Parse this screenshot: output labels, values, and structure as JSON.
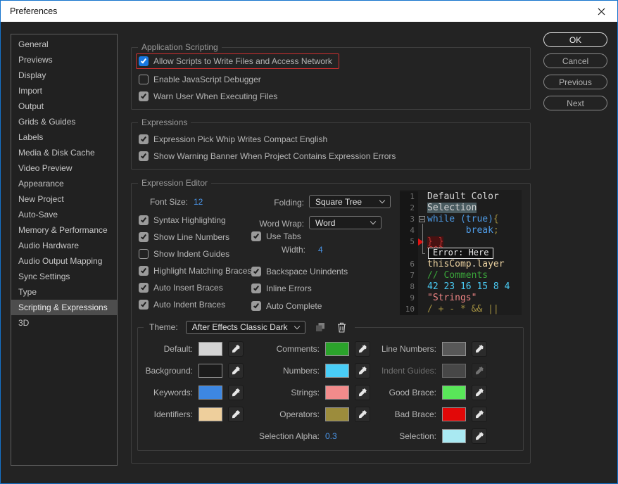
{
  "window": {
    "title": "Preferences"
  },
  "colors": {
    "window_border": "#1473cc",
    "titlebar_bg": "#ffffff",
    "dialog_bg": "#232323",
    "accent_checkbox_blue": "#1878e0",
    "annotation_red": "#d03030",
    "value_blue": "#4a95e8",
    "selection_bg": "#4a5b60",
    "tokens": {
      "def": "#d6d6d6",
      "kw": "#4e9be6",
      "op": "#a18f40",
      "num": "#49c9f2",
      "str": "#ef8585",
      "com": "#3aa53a",
      "id": "#e9d09f",
      "bad": "#bf3333"
    }
  },
  "sidebar": {
    "items": [
      {
        "label": "General",
        "selected": false
      },
      {
        "label": "Previews",
        "selected": false
      },
      {
        "label": "Display",
        "selected": false
      },
      {
        "label": "Import",
        "selected": false
      },
      {
        "label": "Output",
        "selected": false
      },
      {
        "label": "Grids & Guides",
        "selected": false
      },
      {
        "label": "Labels",
        "selected": false
      },
      {
        "label": "Media & Disk Cache",
        "selected": false
      },
      {
        "label": "Video Preview",
        "selected": false
      },
      {
        "label": "Appearance",
        "selected": false
      },
      {
        "label": "New Project",
        "selected": false
      },
      {
        "label": "Auto-Save",
        "selected": false
      },
      {
        "label": "Memory & Performance",
        "selected": false
      },
      {
        "label": "Audio Hardware",
        "selected": false
      },
      {
        "label": "Audio Output Mapping",
        "selected": false
      },
      {
        "label": "Sync Settings",
        "selected": false
      },
      {
        "label": "Type",
        "selected": false
      },
      {
        "label": "Scripting & Expressions",
        "selected": true
      },
      {
        "label": "3D",
        "selected": false
      }
    ]
  },
  "action_buttons": [
    {
      "label": "OK",
      "primary": true
    },
    {
      "label": "Cancel",
      "primary": false
    },
    {
      "label": "Previous",
      "primary": false
    },
    {
      "label": "Next",
      "primary": false
    }
  ],
  "application_scripting": {
    "title": "Application Scripting",
    "checkboxes": [
      {
        "label": "Allow Scripts to Write Files and Access Network",
        "state": "checked-blue",
        "annotated": true
      },
      {
        "label": "Enable JavaScript Debugger",
        "state": "unchecked",
        "annotated": false
      },
      {
        "label": "Warn User When Executing Files",
        "state": "checked",
        "annotated": false
      }
    ]
  },
  "expressions": {
    "title": "Expressions",
    "checkboxes": [
      {
        "label": "Expression Pick Whip Writes Compact English",
        "state": "checked",
        "annotated": false
      },
      {
        "label": "Show Warning Banner When Project Contains Expression Errors",
        "state": "checked",
        "annotated": false
      }
    ]
  },
  "editor": {
    "title": "Expression Editor",
    "font_size_label": "Font Size:",
    "font_size_value": "12",
    "folding_label": "Folding:",
    "folding_value": "Square Tree",
    "word_wrap_label": "Word Wrap:",
    "word_wrap_value": "Word",
    "width_label": "Width:",
    "width_value": "4",
    "left_checkboxes": [
      {
        "label": "Syntax Highlighting",
        "state": "checked",
        "annotated": false
      },
      {
        "label": "Show Line Numbers",
        "state": "checked",
        "annotated": false
      },
      {
        "label": "Show Indent Guides",
        "state": "unchecked",
        "annotated": false
      },
      {
        "label": "Highlight Matching Braces",
        "state": "checked",
        "annotated": false
      },
      {
        "label": "Auto Insert Braces",
        "state": "checked",
        "annotated": false
      },
      {
        "label": "Auto Indent Braces",
        "state": "checked",
        "annotated": false
      }
    ],
    "mid_checkboxes": [
      {
        "label": "Use Tabs",
        "state": "checked",
        "annotated": false
      },
      {
        "label": "Backspace Unindents",
        "state": "checked",
        "annotated": false
      },
      {
        "label": "Inline Errors",
        "state": "checked",
        "annotated": false
      },
      {
        "label": "Auto Complete",
        "state": "checked",
        "annotated": false
      }
    ],
    "preview": {
      "lines": [
        {
          "num": "1",
          "tokens": [
            {
              "t": "Default Color",
              "c": "def"
            }
          ]
        },
        {
          "num": "2",
          "sel": true,
          "tokens": [
            {
              "t": "Selection",
              "c": "def"
            }
          ]
        },
        {
          "num": "3",
          "fold": true,
          "tokens": [
            {
              "t": "while (true)",
              "c": "kw"
            },
            {
              "t": "{",
              "c": "op"
            }
          ]
        },
        {
          "num": "4",
          "tokens": [
            {
              "t": "       break",
              "c": "kw"
            },
            {
              "t": ";",
              "c": "op"
            }
          ]
        },
        {
          "num": "5",
          "arrow": true,
          "bad": true,
          "tokens": [
            {
              "t": "} }",
              "c": "bad"
            }
          ]
        },
        {
          "type": "tooltip",
          "text": "Error: Here"
        },
        {
          "num": "6",
          "tokens": [
            {
              "t": "thisComp",
              "c": "id"
            },
            {
              "t": ".",
              "c": "def"
            },
            {
              "t": "layer",
              "c": "id"
            }
          ]
        },
        {
          "num": "7",
          "tokens": [
            {
              "t": "// Comments",
              "c": "com"
            }
          ]
        },
        {
          "num": "8",
          "tokens": [
            {
              "t": "42 23 16 15 8 4",
              "c": "num"
            }
          ]
        },
        {
          "num": "9",
          "tokens": [
            {
              "t": "\"Strings\"",
              "c": "str"
            }
          ]
        },
        {
          "num": "10",
          "tokens": [
            {
              "t": "/ + - * && ||",
              "c": "op"
            }
          ]
        }
      ]
    },
    "theme": {
      "label": "Theme:",
      "value": "After Effects Classic Dark",
      "duplicate_icon": "duplicate-theme",
      "delete_icon": "delete-theme",
      "selection_alpha_label": "Selection Alpha:",
      "selection_alpha_value": "0.3",
      "swatch_rows": [
        [
          {
            "label": "Default:",
            "color": "#d4d4d4"
          },
          {
            "label": "Comments:",
            "color": "#2ba32b"
          },
          {
            "label": "Line Numbers:",
            "color": "#585858"
          }
        ],
        [
          {
            "label": "Background:",
            "color": "#1b1b1b"
          },
          {
            "label": "Numbers:",
            "color": "#49cdf7"
          },
          {
            "label": "Indent Guides:",
            "color": "#474747",
            "disabled": true
          }
        ],
        [
          {
            "label": "Keywords:",
            "color": "#3d87e2"
          },
          {
            "label": "Strings:",
            "color": "#f28b8b"
          },
          {
            "label": "Good Brace:",
            "color": "#59e659"
          }
        ],
        [
          {
            "label": "Identifiers:",
            "color": "#eecf9c"
          },
          {
            "label": "Operators:",
            "color": "#9c8c3c"
          },
          {
            "label": "Bad Brace:",
            "color": "#e20808"
          }
        ],
        [
          null,
          {
            "alpha": true
          },
          {
            "label": "Selection:",
            "color": "#a9e9f2"
          }
        ]
      ]
    }
  }
}
